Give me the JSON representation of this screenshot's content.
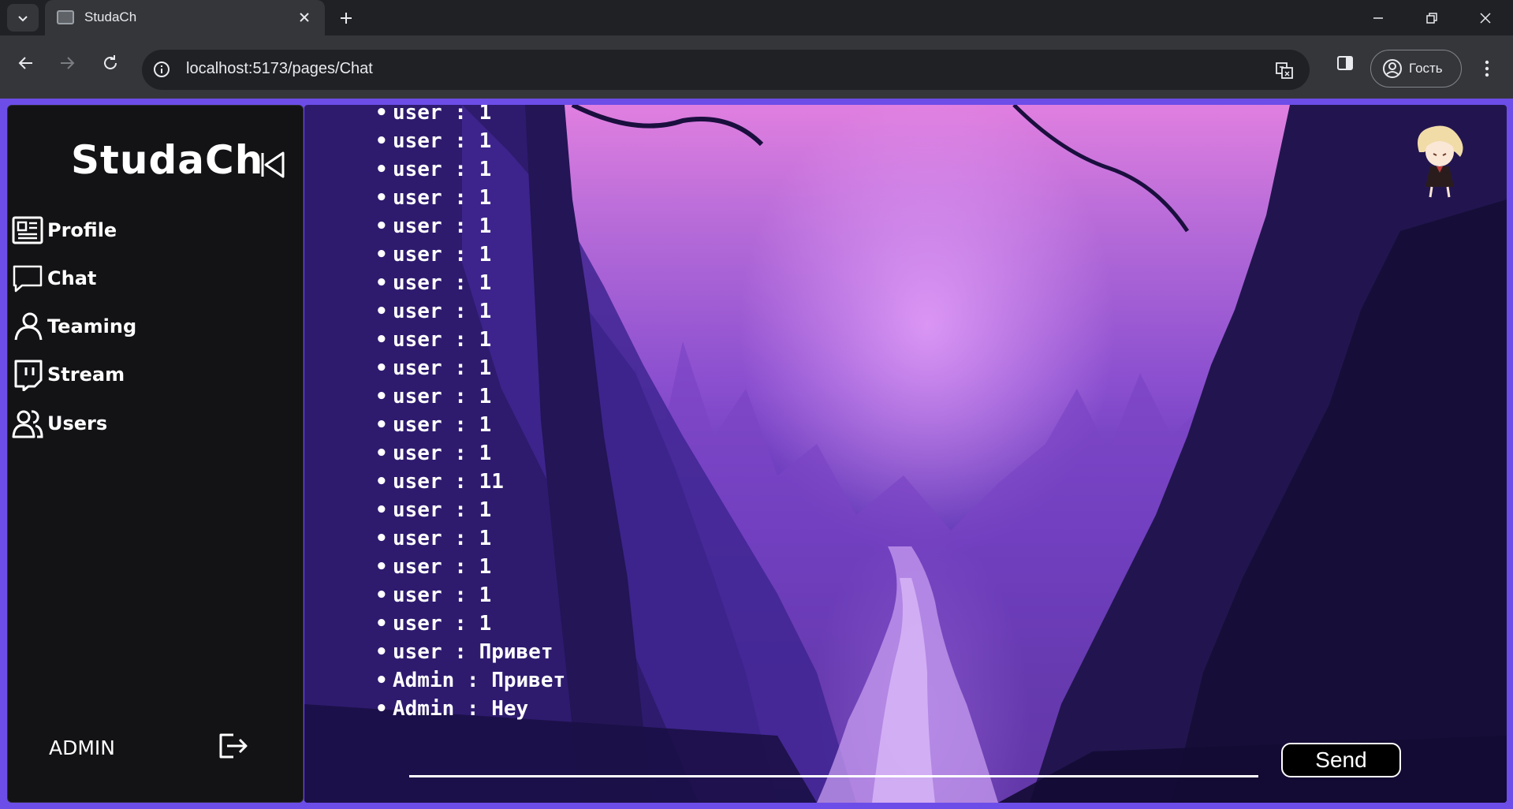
{
  "browser": {
    "tab_title": "StudaCh",
    "url": "localhost:5173/pages/Chat",
    "profile_label": "Гость"
  },
  "sidebar": {
    "logo": "StudaCh",
    "items": [
      {
        "label": "Profile",
        "icon": "profile-card-icon"
      },
      {
        "label": "Chat",
        "icon": "chat-bubble-icon"
      },
      {
        "label": "Teaming",
        "icon": "person-icon"
      },
      {
        "label": "Stream",
        "icon": "stream-icon"
      },
      {
        "label": "Users",
        "icon": "users-icon"
      }
    ],
    "username": "ADMIN"
  },
  "chat": {
    "messages": [
      "user : 1",
      "user : 1",
      "user : 1",
      "user : 1",
      "user : 1",
      "user : 1",
      "user : 1",
      "user : 1",
      "user : 1",
      "user : 1",
      "user : 1",
      "user : 1",
      "user : 1",
      "user : 11",
      "user : 1",
      "user : 1",
      "user : 1",
      "user : 1",
      "user : 1",
      "user : Привет",
      "Admin : Привет",
      "Admin : Hey"
    ],
    "input_value": "",
    "send_label": "Send"
  },
  "colors": {
    "accent": "#6d4de8",
    "sidebar_bg": "#131316"
  }
}
